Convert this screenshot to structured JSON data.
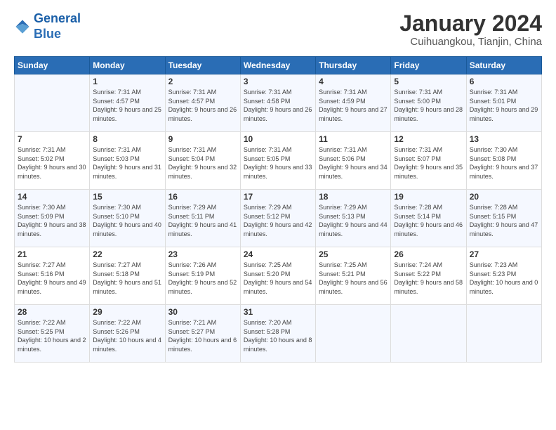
{
  "header": {
    "logo_line1": "General",
    "logo_line2": "Blue",
    "month": "January 2024",
    "location": "Cuihuangkou, Tianjin, China"
  },
  "days_of_week": [
    "Sunday",
    "Monday",
    "Tuesday",
    "Wednesday",
    "Thursday",
    "Friday",
    "Saturday"
  ],
  "weeks": [
    [
      {
        "day": "",
        "info": ""
      },
      {
        "day": "1",
        "info": "Sunrise: 7:31 AM\nSunset: 4:57 PM\nDaylight: 9 hours\nand 25 minutes."
      },
      {
        "day": "2",
        "info": "Sunrise: 7:31 AM\nSunset: 4:57 PM\nDaylight: 9 hours\nand 26 minutes."
      },
      {
        "day": "3",
        "info": "Sunrise: 7:31 AM\nSunset: 4:58 PM\nDaylight: 9 hours\nand 26 minutes."
      },
      {
        "day": "4",
        "info": "Sunrise: 7:31 AM\nSunset: 4:59 PM\nDaylight: 9 hours\nand 27 minutes."
      },
      {
        "day": "5",
        "info": "Sunrise: 7:31 AM\nSunset: 5:00 PM\nDaylight: 9 hours\nand 28 minutes."
      },
      {
        "day": "6",
        "info": "Sunrise: 7:31 AM\nSunset: 5:01 PM\nDaylight: 9 hours\nand 29 minutes."
      }
    ],
    [
      {
        "day": "7",
        "info": "Sunrise: 7:31 AM\nSunset: 5:02 PM\nDaylight: 9 hours\nand 30 minutes."
      },
      {
        "day": "8",
        "info": "Sunrise: 7:31 AM\nSunset: 5:03 PM\nDaylight: 9 hours\nand 31 minutes."
      },
      {
        "day": "9",
        "info": "Sunrise: 7:31 AM\nSunset: 5:04 PM\nDaylight: 9 hours\nand 32 minutes."
      },
      {
        "day": "10",
        "info": "Sunrise: 7:31 AM\nSunset: 5:05 PM\nDaylight: 9 hours\nand 33 minutes."
      },
      {
        "day": "11",
        "info": "Sunrise: 7:31 AM\nSunset: 5:06 PM\nDaylight: 9 hours\nand 34 minutes."
      },
      {
        "day": "12",
        "info": "Sunrise: 7:31 AM\nSunset: 5:07 PM\nDaylight: 9 hours\nand 35 minutes."
      },
      {
        "day": "13",
        "info": "Sunrise: 7:30 AM\nSunset: 5:08 PM\nDaylight: 9 hours\nand 37 minutes."
      }
    ],
    [
      {
        "day": "14",
        "info": "Sunrise: 7:30 AM\nSunset: 5:09 PM\nDaylight: 9 hours\nand 38 minutes."
      },
      {
        "day": "15",
        "info": "Sunrise: 7:30 AM\nSunset: 5:10 PM\nDaylight: 9 hours\nand 40 minutes."
      },
      {
        "day": "16",
        "info": "Sunrise: 7:29 AM\nSunset: 5:11 PM\nDaylight: 9 hours\nand 41 minutes."
      },
      {
        "day": "17",
        "info": "Sunrise: 7:29 AM\nSunset: 5:12 PM\nDaylight: 9 hours\nand 42 minutes."
      },
      {
        "day": "18",
        "info": "Sunrise: 7:29 AM\nSunset: 5:13 PM\nDaylight: 9 hours\nand 44 minutes."
      },
      {
        "day": "19",
        "info": "Sunrise: 7:28 AM\nSunset: 5:14 PM\nDaylight: 9 hours\nand 46 minutes."
      },
      {
        "day": "20",
        "info": "Sunrise: 7:28 AM\nSunset: 5:15 PM\nDaylight: 9 hours\nand 47 minutes."
      }
    ],
    [
      {
        "day": "21",
        "info": "Sunrise: 7:27 AM\nSunset: 5:16 PM\nDaylight: 9 hours\nand 49 minutes."
      },
      {
        "day": "22",
        "info": "Sunrise: 7:27 AM\nSunset: 5:18 PM\nDaylight: 9 hours\nand 51 minutes."
      },
      {
        "day": "23",
        "info": "Sunrise: 7:26 AM\nSunset: 5:19 PM\nDaylight: 9 hours\nand 52 minutes."
      },
      {
        "day": "24",
        "info": "Sunrise: 7:25 AM\nSunset: 5:20 PM\nDaylight: 9 hours\nand 54 minutes."
      },
      {
        "day": "25",
        "info": "Sunrise: 7:25 AM\nSunset: 5:21 PM\nDaylight: 9 hours\nand 56 minutes."
      },
      {
        "day": "26",
        "info": "Sunrise: 7:24 AM\nSunset: 5:22 PM\nDaylight: 9 hours\nand 58 minutes."
      },
      {
        "day": "27",
        "info": "Sunrise: 7:23 AM\nSunset: 5:23 PM\nDaylight: 10 hours\nand 0 minutes."
      }
    ],
    [
      {
        "day": "28",
        "info": "Sunrise: 7:22 AM\nSunset: 5:25 PM\nDaylight: 10 hours\nand 2 minutes."
      },
      {
        "day": "29",
        "info": "Sunrise: 7:22 AM\nSunset: 5:26 PM\nDaylight: 10 hours\nand 4 minutes."
      },
      {
        "day": "30",
        "info": "Sunrise: 7:21 AM\nSunset: 5:27 PM\nDaylight: 10 hours\nand 6 minutes."
      },
      {
        "day": "31",
        "info": "Sunrise: 7:20 AM\nSunset: 5:28 PM\nDaylight: 10 hours\nand 8 minutes."
      },
      {
        "day": "",
        "info": ""
      },
      {
        "day": "",
        "info": ""
      },
      {
        "day": "",
        "info": ""
      }
    ]
  ]
}
